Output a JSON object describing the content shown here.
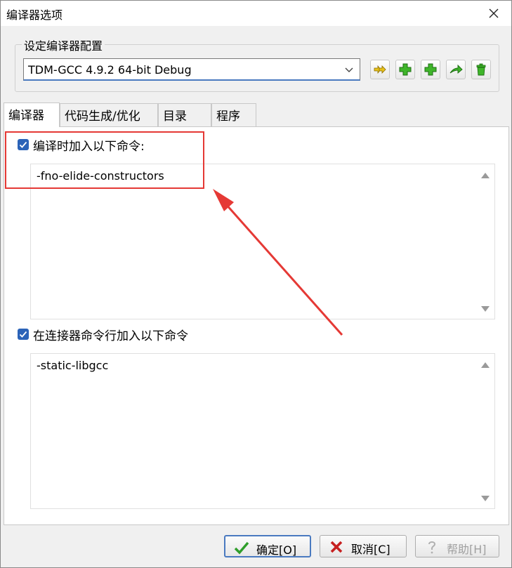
{
  "window": {
    "title": "编译器选项"
  },
  "config": {
    "group_label": "设定编译器配置",
    "selected_compiler": "TDM-GCC 4.9.2 64-bit Debug",
    "tool_icons": [
      "add-compiler-icon",
      "add-icon",
      "add-copy-icon",
      "rename-icon",
      "delete-icon"
    ]
  },
  "tabs": [
    {
      "label": "编译器",
      "active": true
    },
    {
      "label": "代码生成/优化",
      "active": false
    },
    {
      "label": "目录",
      "active": false
    },
    {
      "label": "程序",
      "active": false
    }
  ],
  "compiler_commands": {
    "checkbox_label": "编译时加入以下命令:",
    "checked": true,
    "value": "-fno-elide-constructors"
  },
  "linker_commands": {
    "checkbox_label": "在连接器命令行加入以下命令",
    "checked": true,
    "value": "-static-libgcc"
  },
  "buttons": {
    "ok": "确定[O]",
    "cancel": "取消[C]",
    "help": "帮助[H]"
  },
  "colors": {
    "accent": "#2b63b8",
    "annotation": "#e53935"
  }
}
